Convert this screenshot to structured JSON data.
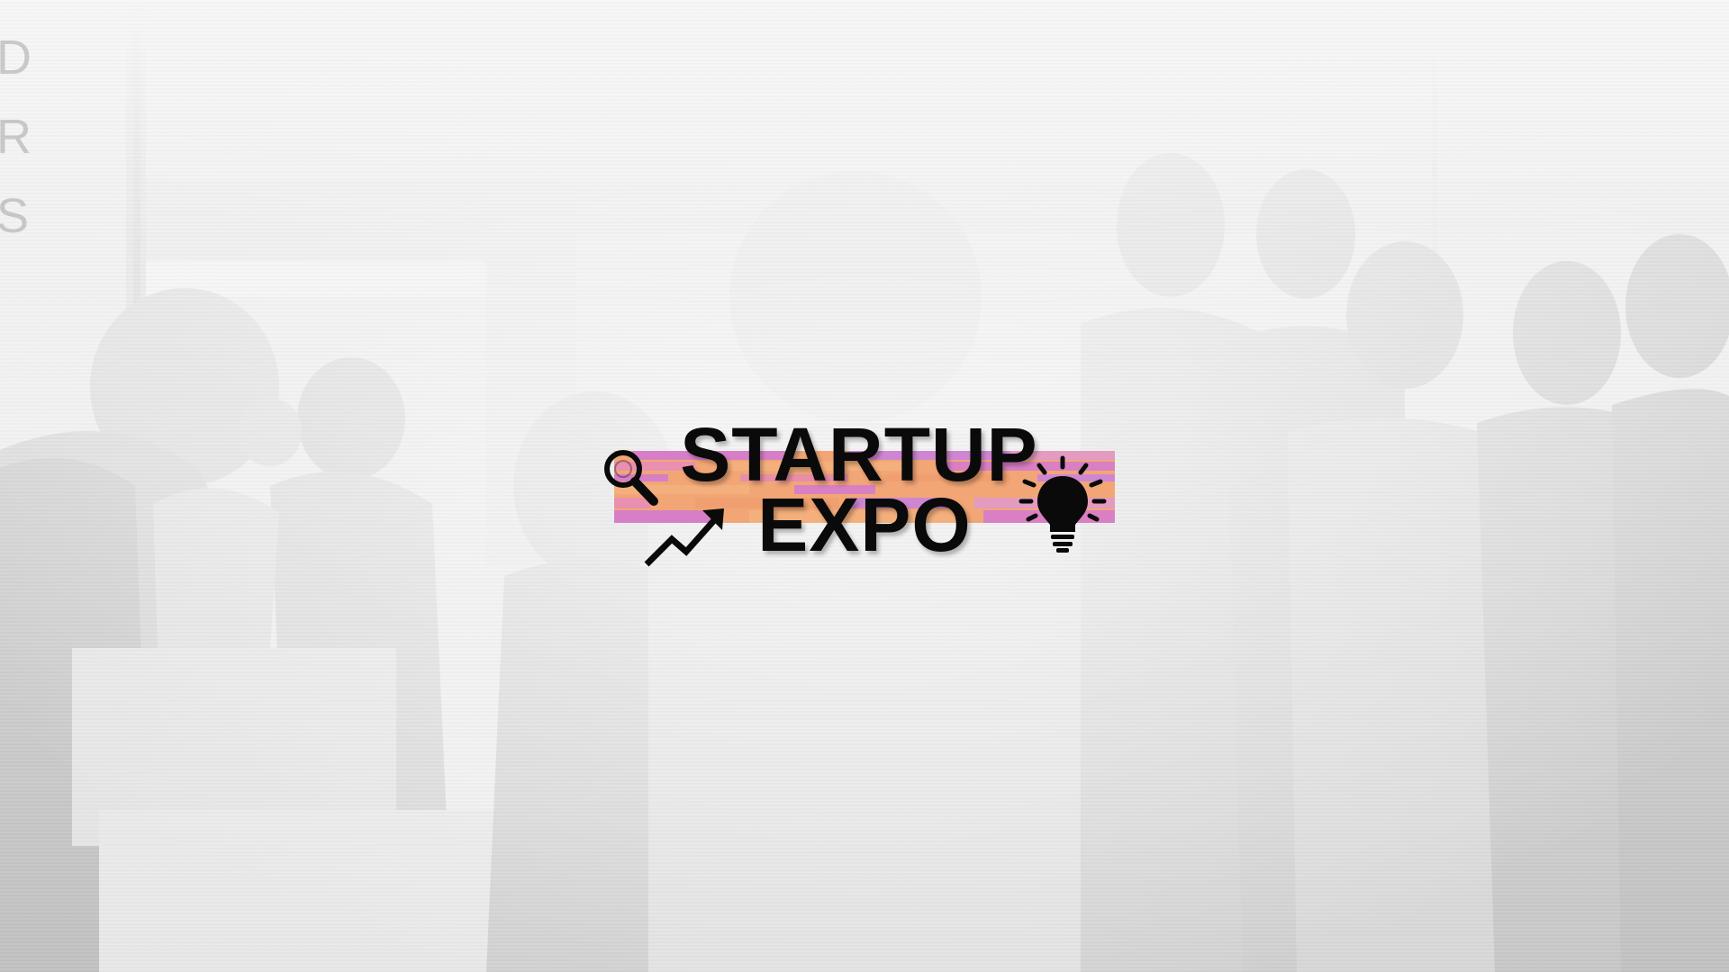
{
  "logo": {
    "line1": "STARTUP",
    "line2": "EXPO",
    "text_color": "#0a0a0a",
    "band_colors": [
      "#f0a070",
      "#d97fc4",
      "#f4b07c",
      "#e98fb0",
      "#cf86d2"
    ]
  },
  "background": {
    "side_letters": [
      "D",
      "R",
      "S"
    ],
    "tone": "#e6e6e6"
  },
  "icons": {
    "left_top": "magnifier-icon",
    "left_bottom": "trend-up-arrow-icon",
    "right": "light-bulb-icon"
  }
}
